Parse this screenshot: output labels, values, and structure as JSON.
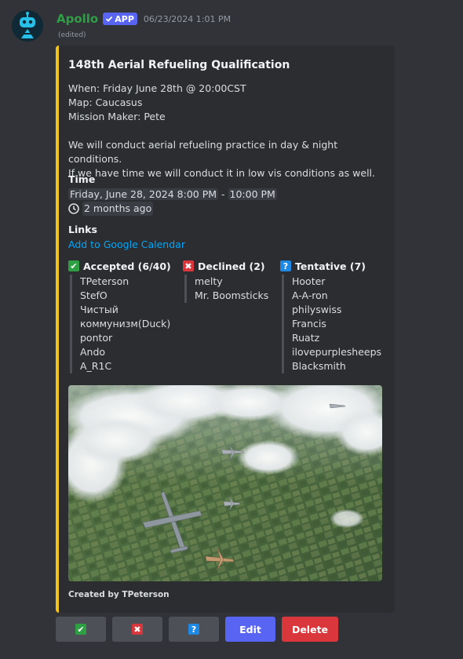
{
  "message": {
    "username": "Apollo",
    "app_badge": "APP",
    "timestamp": "06/23/2024 1:01 PM",
    "edited": "(edited)"
  },
  "embed": {
    "title": "148th Aerial Refueling Qualification",
    "when": "When: Friday June 28th @ 20:00CST",
    "map": "Map: Caucasus",
    "mission_maker": "Mission Maker: Pete",
    "description_1": "We will conduct aerial refueling practice in day & night conditions.",
    "description_2": "If we have time we will conduct it in low vis conditions as well.",
    "time_label": "Time",
    "time_start": "Friday, June 28, 2024 8:00 PM",
    "time_sep": " - ",
    "time_end": "10:00 PM",
    "time_relative": "2 months ago",
    "links_label": "Links",
    "calendar_link": "Add to Google Calendar",
    "accepted": {
      "label": "Accepted (6/40)",
      "icon": "check-icon",
      "color": "#2ea043",
      "names": [
        "TPeterson",
        "StefO",
        "Чистый",
        "коммунизм(Duck)",
        "pontor",
        "Ando",
        "A_R1C"
      ]
    },
    "declined": {
      "label": "Declined (2)",
      "icon": "cross-icon",
      "color": "#da373c",
      "names": [
        "melty",
        "Mr. Boomsticks"
      ]
    },
    "tentative": {
      "label": "Tentative (7)",
      "icon": "question-icon",
      "color": "#1e88e5",
      "names": [
        "Hooter",
        "A-A-ron",
        "philyswiss",
        "Francis",
        "Ruatz",
        "ilovepurplesheeps",
        "Blacksmith"
      ]
    },
    "footer": "Created by TPeterson",
    "accent_color": "#f0c419"
  },
  "buttons": {
    "accept_icon": "✔",
    "decline_icon": "✖",
    "tentative_icon": "?",
    "edit": "Edit",
    "delete": "Delete"
  }
}
